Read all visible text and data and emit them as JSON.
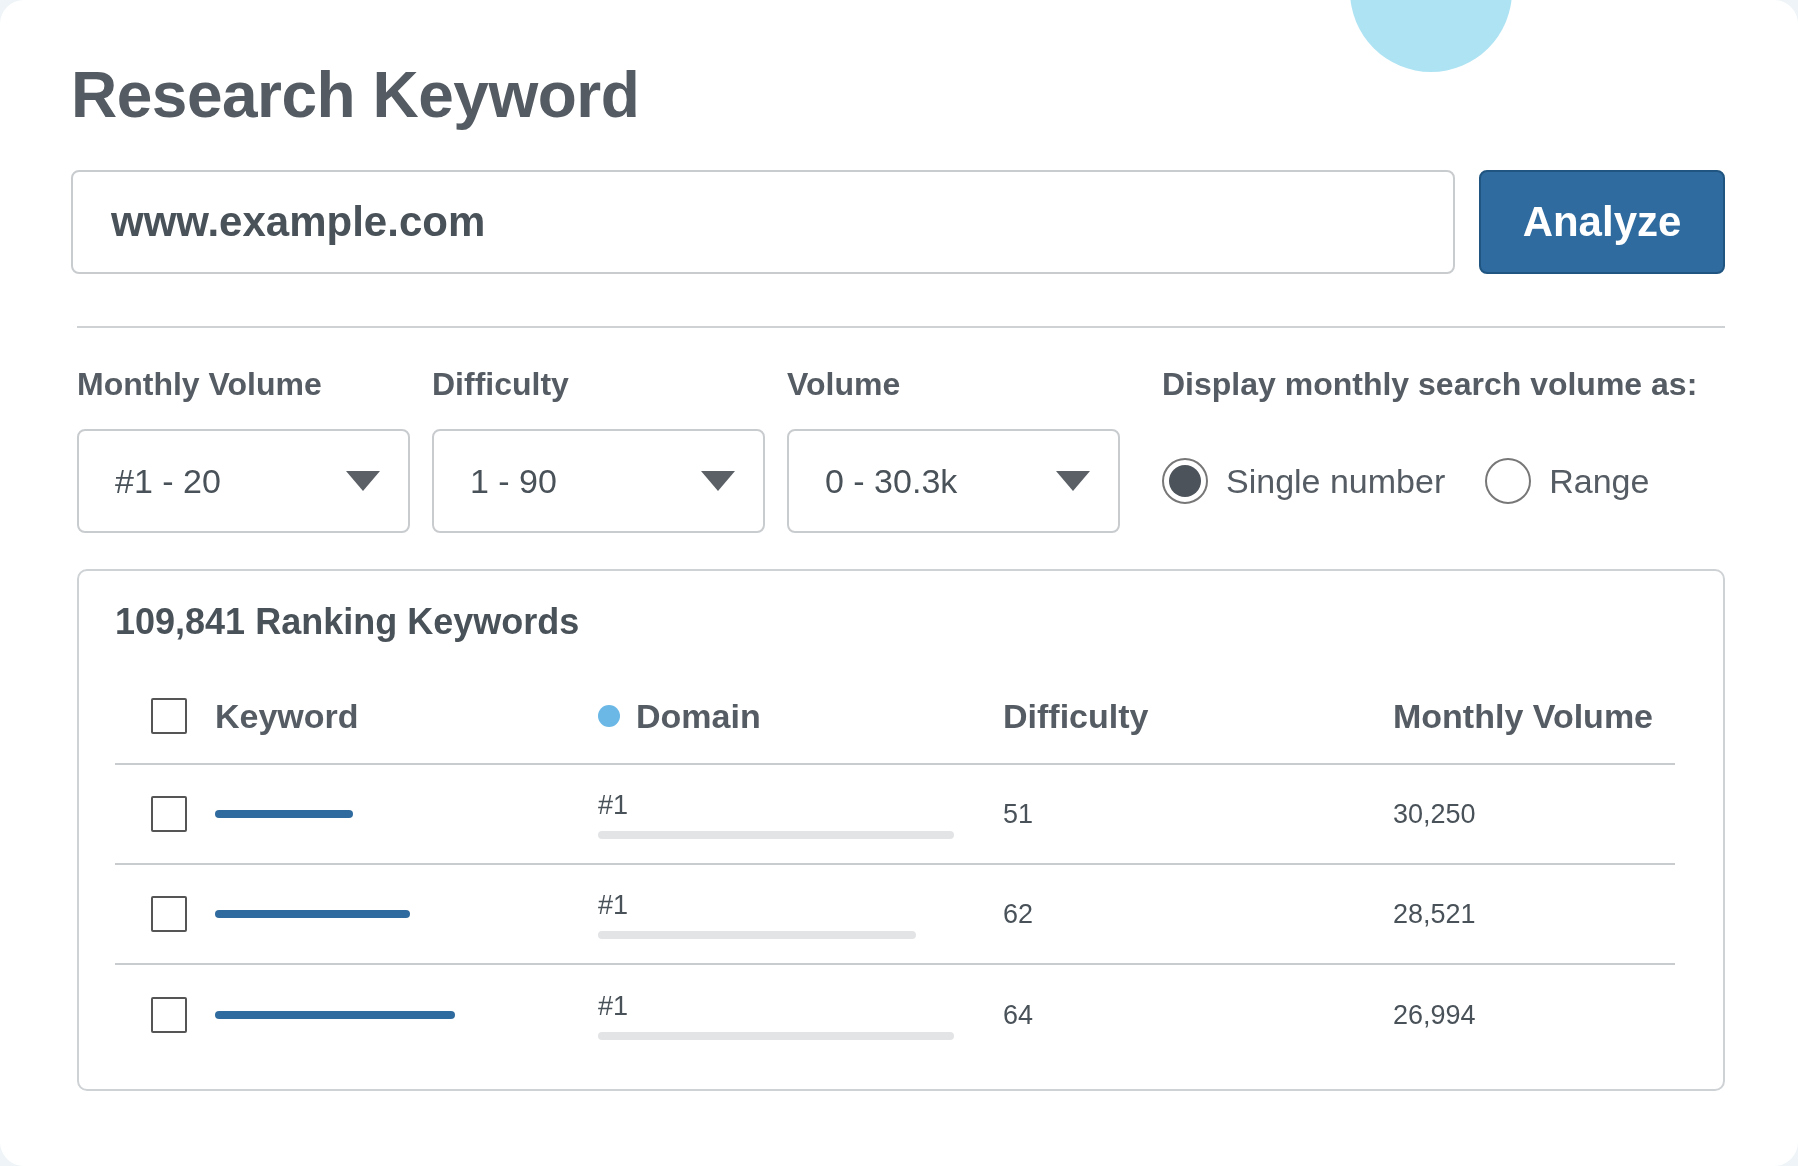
{
  "title": "Research Keyword",
  "search": {
    "value": "www.example.com"
  },
  "analyze_button": "Analyze",
  "filters": [
    {
      "label": "Monthly Volume",
      "value": "#1 - 20"
    },
    {
      "label": "Difficulty",
      "value": "1 - 90"
    },
    {
      "label": "Volume",
      "value": "0 - 30.3k"
    }
  ],
  "display_option": {
    "label": "Display monthly search volume as:",
    "options": [
      {
        "label": "Single number",
        "selected": true
      },
      {
        "label": "Range",
        "selected": false
      }
    ]
  },
  "results": {
    "title": "109,841 Ranking Keywords",
    "select_all": {
      "checked": false
    },
    "columns": [
      "Keyword",
      "Domain",
      "Difficulty",
      "Monthly Volume"
    ],
    "rows": [
      {
        "checked": false,
        "rank": "#1",
        "difficulty": "51",
        "volume": "30,250"
      },
      {
        "checked": false,
        "rank": "#1",
        "difficulty": "62",
        "volume": "28,521"
      },
      {
        "checked": false,
        "rank": "#1",
        "difficulty": "64",
        "volume": "26,994"
      }
    ]
  }
}
